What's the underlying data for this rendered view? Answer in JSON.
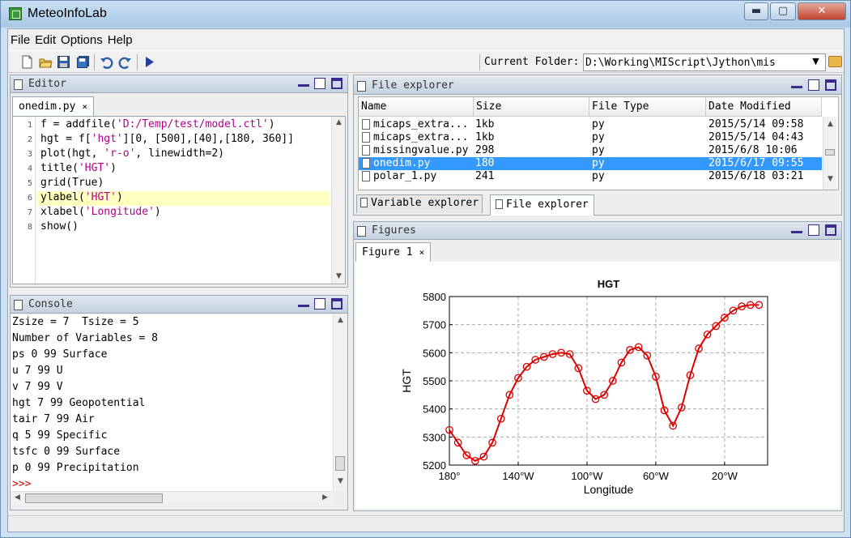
{
  "window": {
    "title": "MeteoInfoLab",
    "min_label": "▬",
    "max_label": "▢",
    "close_label": "✕"
  },
  "menu": [
    "File",
    "Edit",
    "Options",
    "Help"
  ],
  "toolbar": {
    "current_folder_label": "Current Folder:",
    "current_folder_value": "D:\\Working\\MIScript\\Jython\\mis"
  },
  "editor": {
    "panel_title": "Editor",
    "tab_label": "onedim.py",
    "tab_close": "×",
    "lines": [
      {
        "num": "1",
        "text": "f = addfile('D:/Temp/test/model.ctl')"
      },
      {
        "num": "2",
        "text": "hgt = f['hgt'][0, [500],[40],[180, 360]]"
      },
      {
        "num": "3",
        "text": "plot(hgt, 'r-o', linewidth=2)"
      },
      {
        "num": "4",
        "text": "title('HGT')"
      },
      {
        "num": "5",
        "text": "grid(True)"
      },
      {
        "num": "6",
        "text": "ylabel('HGT')"
      },
      {
        "num": "7",
        "text": "xlabel('Longitude')"
      },
      {
        "num": "8",
        "text": "show()"
      }
    ]
  },
  "console": {
    "panel_title": "Console",
    "lines": [
      "Zsize = 7  Tsize = 5",
      "Number of Variables = 8",
      "ps 0 99 Surface",
      "u 7 99 U",
      "v 7 99 V",
      "hgt 7 99 Geopotential",
      "tair 7 99 Air",
      "q 5 99 Specific",
      "tsfc 0 99 Surface",
      "p 0 99 Precipitation"
    ],
    "prompt": ">>>"
  },
  "file_explorer": {
    "panel_title": "File explorer",
    "columns": [
      "Name",
      "Size",
      "File Type",
      "Date Modified"
    ],
    "rows": [
      {
        "name": "micaps_extra...",
        "size": "1kb",
        "type": "py",
        "date": "2015/5/14 09:58",
        "selected": false
      },
      {
        "name": "micaps_extra...",
        "size": "1kb",
        "type": "py",
        "date": "2015/5/14 04:43",
        "selected": false
      },
      {
        "name": "missingvalue.py",
        "size": "298",
        "type": "py",
        "date": "2015/6/8 10:06",
        "selected": false
      },
      {
        "name": "onedim.py",
        "size": "180",
        "type": "py",
        "date": "2015/6/17 09:55",
        "selected": true
      },
      {
        "name": "polar_1.py",
        "size": "241",
        "type": "py",
        "date": "2015/6/18 03:21",
        "selected": false
      }
    ],
    "bottom_tabs": [
      "Variable explorer",
      "File explorer"
    ]
  },
  "figures": {
    "panel_title": "Figures",
    "tab_label": "Figure 1",
    "tab_close": "×"
  },
  "colors": {
    "accent_selection": "#3399ff",
    "line_highlight": "#ffffc0",
    "series_color": "#dd0000",
    "string_color": "#b0008a"
  },
  "chart_data": {
    "type": "line",
    "title": "HGT",
    "xlabel": "Longitude",
    "ylabel": "HGT",
    "xlim": [
      180,
      365
    ],
    "ylim": [
      5200,
      5800
    ],
    "xticks": [
      180,
      220,
      260,
      300,
      340
    ],
    "xtick_labels": [
      "180°",
      "140°W",
      "100°W",
      "60°W",
      "20°W"
    ],
    "yticks": [
      5200,
      5300,
      5400,
      5500,
      5600,
      5700,
      5800
    ],
    "ytick_labels": [
      "5200",
      "5300",
      "5400",
      "5500",
      "5600",
      "5700",
      "5800"
    ],
    "grid": true,
    "series": [
      {
        "marker": "circle",
        "x": [
          180,
          185,
          190,
          195,
          200,
          205,
          210,
          215,
          220,
          225,
          230,
          235,
          240,
          245,
          250,
          255,
          260,
          265,
          270,
          275,
          280,
          285,
          290,
          295,
          300,
          305,
          310,
          315,
          320,
          325,
          330,
          335,
          340,
          345,
          350,
          355,
          360
        ],
        "y": [
          5325,
          5280,
          5235,
          5215,
          5230,
          5280,
          5365,
          5450,
          5510,
          5550,
          5575,
          5585,
          5595,
          5600,
          5595,
          5545,
          5465,
          5435,
          5450,
          5500,
          5565,
          5610,
          5620,
          5590,
          5515,
          5395,
          5340,
          5405,
          5520,
          5615,
          5665,
          5695,
          5725,
          5750,
          5765,
          5770,
          5770
        ]
      }
    ]
  }
}
